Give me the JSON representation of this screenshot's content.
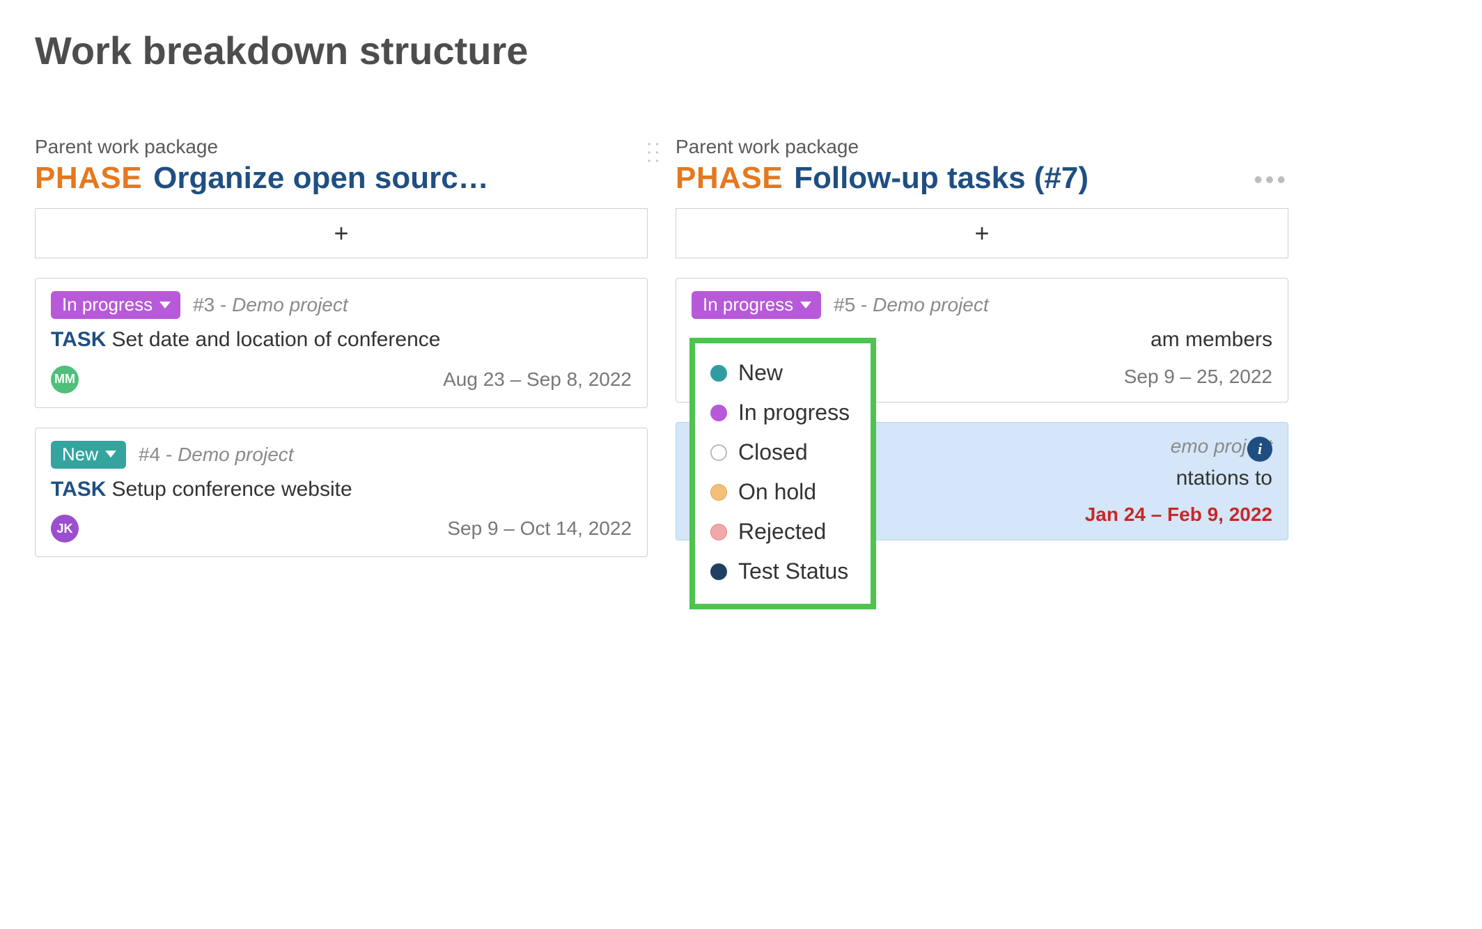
{
  "page_title": "Work breakdown structure",
  "columns": [
    {
      "subtitle": "Parent work package",
      "phase_label": "PHASE",
      "title": "Organize open sourc…",
      "add_label": "+",
      "cards": [
        {
          "status_label": "In progress",
          "status_class": "inprogress",
          "id": "#3",
          "project": "Demo project",
          "type_label": "TASK",
          "title": "Set date and location of conference",
          "avatar_initials": "MM",
          "avatar_class": "green",
          "date_range": "Aug 23 – Sep 8, 2022",
          "date_class": ""
        },
        {
          "status_label": "New",
          "status_class": "new",
          "id": "#4",
          "project": "Demo project",
          "type_label": "TASK",
          "title": "Setup conference website",
          "avatar_initials": "JK",
          "avatar_class": "purple",
          "date_range": "Sep 9 – Oct 14, 2022",
          "date_class": ""
        }
      ]
    },
    {
      "subtitle": "Parent work package",
      "phase_label": "PHASE",
      "title": "Follow-up tasks (#7)",
      "add_label": "+",
      "more_label": "•••",
      "cards": [
        {
          "status_label": "In progress",
          "status_class": "inprogress",
          "id": "#5",
          "project": "Demo project",
          "type_label": "",
          "title_fragment": "am members",
          "avatar_initials": "",
          "avatar_class": "",
          "date_range": "Sep 9 – 25, 2022",
          "date_class": ""
        },
        {
          "status_label": "",
          "status_class": "",
          "id": "",
          "project": "emo project",
          "type_label": "",
          "title_fragment": "ntations to",
          "avatar_initials": "",
          "avatar_class": "",
          "date_range": "Jan 24 – Feb 9, 2022",
          "date_class": "overdue",
          "highlight": true,
          "info": true
        }
      ]
    }
  ],
  "status_options": [
    {
      "label": "New",
      "dot": "teal"
    },
    {
      "label": "In progress",
      "dot": "purple"
    },
    {
      "label": "Closed",
      "dot": "grey"
    },
    {
      "label": "On hold",
      "dot": "orange"
    },
    {
      "label": "Rejected",
      "dot": "pink"
    },
    {
      "label": "Test Status",
      "dot": "navy"
    }
  ]
}
